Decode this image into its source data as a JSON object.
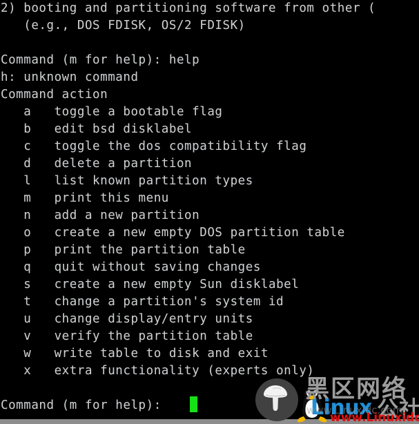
{
  "terminal": {
    "program": "fdisk",
    "colors": {
      "background": "#000000",
      "foreground": "#cfcfcf",
      "cursor": "#16e016",
      "status_bar": "#8d8d8d"
    },
    "lines": [
      "2) booting and partitioning software from other (",
      "   (e.g., DOS FDISK, OS/2 FDISK)",
      "",
      "Command (m for help): help",
      "h: unknown command",
      "Command action",
      "   a   toggle a bootable flag",
      "   b   edit bsd disklabel",
      "   c   toggle the dos compatibility flag",
      "   d   delete a partition",
      "   l   list known partition types",
      "   m   print this menu",
      "   n   add a new partition",
      "   o   create a new empty DOS partition table",
      "   p   print the partition table",
      "   q   quit without saving changes",
      "   s   create a new empty Sun disklabel",
      "   t   change a partition's system id",
      "   u   change display/entry units",
      "   v   verify the partition table",
      "   w   write table to disk and exit",
      "   x   extra functionality (experts only)",
      "",
      "Command (m for help): "
    ],
    "prompt": {
      "text": "Command (m for help): ",
      "typed_command": "help",
      "error_response": "h: unknown command",
      "menu_header": "Command action"
    },
    "commands": [
      {
        "key": "a",
        "description": "toggle a bootable flag"
      },
      {
        "key": "b",
        "description": "edit bsd disklabel"
      },
      {
        "key": "c",
        "description": "toggle the dos compatibility flag"
      },
      {
        "key": "d",
        "description": "delete a partition"
      },
      {
        "key": "l",
        "description": "list known partition types"
      },
      {
        "key": "m",
        "description": "print this menu"
      },
      {
        "key": "n",
        "description": "add a new partition"
      },
      {
        "key": "o",
        "description": "create a new empty DOS partition table"
      },
      {
        "key": "p",
        "description": "print the partition table"
      },
      {
        "key": "q",
        "description": "quit without saving changes"
      },
      {
        "key": "s",
        "description": "create a new empty Sun disklabel"
      },
      {
        "key": "t",
        "description": "change a partition's system id"
      },
      {
        "key": "u",
        "description": "change display/entry units"
      },
      {
        "key": "v",
        "description": "verify the partition table"
      },
      {
        "key": "w",
        "description": "write table to disk and exit"
      },
      {
        "key": "x",
        "description": "extra functionality (experts only)"
      }
    ]
  },
  "watermark": {
    "cjk_top": "黑区网络",
    "cjk_bottom": "公社",
    "brand": "Linux",
    "ghost_url": "www.Linuxidc.com",
    "red_url": "www.Linuxidc.com",
    "colors": {
      "brand": "#1f8ed6",
      "url": "#e21212",
      "cjk": "#9c9c9c",
      "badge": "#414141"
    },
    "icons": {
      "mushroom": "mushroom-icon",
      "penguin": "tux-penguin-icon"
    }
  }
}
